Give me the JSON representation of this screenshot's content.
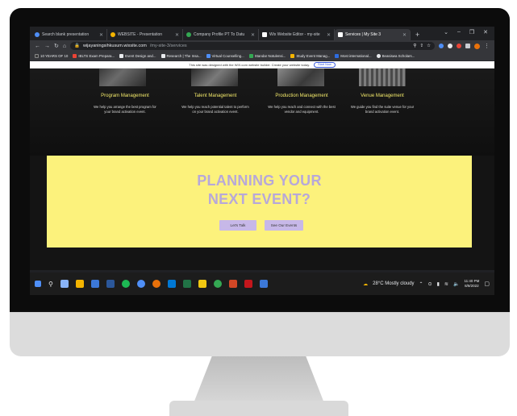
{
  "browser": {
    "tabs": [
      {
        "label": "Search blank presentation",
        "active": false,
        "favicon": "google-icon"
      },
      {
        "label": "WEBSITE - Presentation",
        "active": false,
        "favicon": "google-icon"
      },
      {
        "label": "Company Profile PT To Datu",
        "active": false,
        "favicon": "google-icon"
      },
      {
        "label": "Wix Website Editor - my-site",
        "active": false,
        "favicon": "wix-icon"
      },
      {
        "label": "Services | My Site 3",
        "active": true,
        "favicon": "wix-icon"
      }
    ],
    "new_tab": "+",
    "address": {
      "host": "wijayaningsihkusum.wixsite.com",
      "path": "/my-site-3/services"
    },
    "bookmarks": [
      "10 YEARS OF 10",
      "IELTS Exam Prepara...",
      "Event Design and...",
      "Research | The Insa...",
      "Virtual Counselling...",
      "Standar Notulensi...",
      "Study Event Manag...",
      "Most international...",
      "Beasiswa Scholars..."
    ]
  },
  "wix_banner": {
    "text": "This site was designed with the WIX.com website builder. Create your website today.",
    "button": "Start Now"
  },
  "services": [
    {
      "title": "Program Management",
      "desc": "We help you arrange the best program for your brand activation event."
    },
    {
      "title": "Talent Management",
      "desc": "We help you reach potential talent to perform on your brand activation event."
    },
    {
      "title": "Production Management",
      "desc": "We help you reach and connect with the best vendor and equipment."
    },
    {
      "title": "Venue Management",
      "desc": "We guide you find the suite venue for your brand activation event."
    }
  ],
  "cta": {
    "headline_line1": "PLANNING YOUR",
    "headline_line2": "NEXT EVENT?",
    "button_talk": "Let's Talk",
    "button_events": "See Our Events"
  },
  "taskbar": {
    "weather": "28°C Mostly cloudy",
    "time": "11:40 PM",
    "date": "8/9/2022"
  },
  "colors": {
    "accent_yellow": "#fcf27c",
    "title_yellow": "#f3e96a",
    "lavender": "#b7a8d9",
    "button_lavender": "#c7b8e8"
  }
}
